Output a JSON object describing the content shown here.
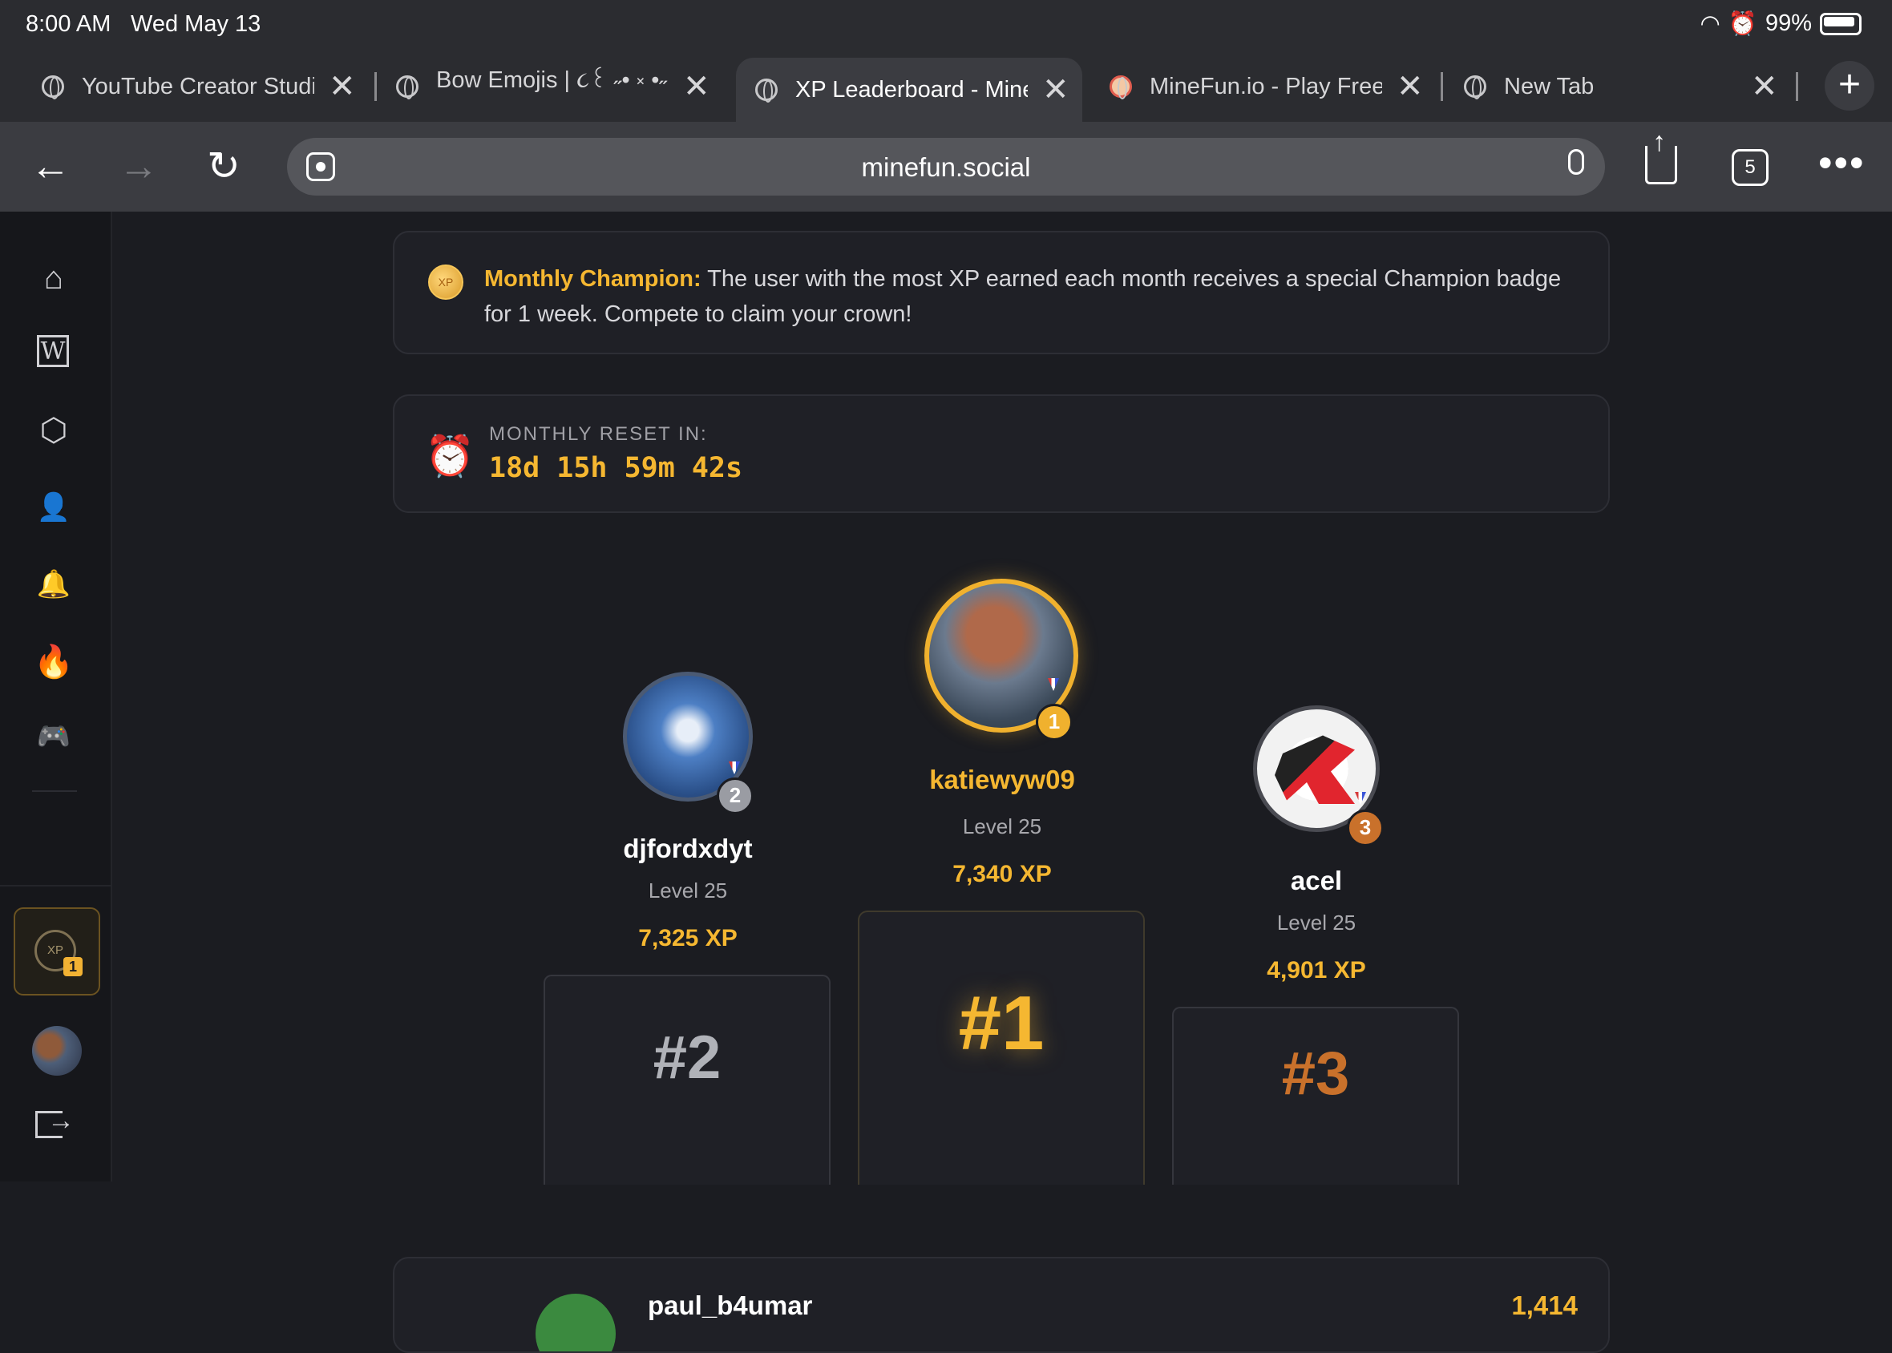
{
  "status": {
    "time": "8:00 AM",
    "date": "Wed May 13",
    "battery": "99%"
  },
  "tabs": [
    {
      "title": "YouTube Creator Studio"
    },
    {
      "title": "Bow Emojis | ૮꒰ ˶• ༝ •˶꒱ა"
    },
    {
      "title": "XP Leaderboard - MineFun"
    },
    {
      "title": "MineFun.io - Play Free"
    },
    {
      "title": "New Tab"
    }
  ],
  "toolbar": {
    "url": "minefun.social",
    "tab_count": "5"
  },
  "sidebar": {
    "icons": [
      "home-icon",
      "wiki-icon",
      "cube-icon",
      "add-user-icon",
      "bell-icon",
      "fire-icon",
      "discord-icon"
    ],
    "xp_badge": "1",
    "xp_ring_label": "XP"
  },
  "champion": {
    "label": "Monthly Champion:",
    "text": " The user with the most XP earned each month receives a special Champion badge for 1 week. Compete to claim your crown!",
    "coin": "XP"
  },
  "reset": {
    "label": "MONTHLY RESET IN:",
    "time": "18d 15h 59m 42s"
  },
  "podium": {
    "first": {
      "name": "katiewyw09",
      "level": "Level 25",
      "xp": "7,340 XP",
      "rank": "#1",
      "badge": "1"
    },
    "second": {
      "name": "djfordxdyt",
      "level": "Level 25",
      "xp": "7,325 XP",
      "rank": "#2",
      "badge": "2"
    },
    "third": {
      "name": "acel",
      "level": "Level 25",
      "xp": "4,901 XP",
      "rank": "#3",
      "badge": "3"
    }
  },
  "next_entry": {
    "name": "paul_b4umar",
    "xp": "1,414"
  },
  "colors": {
    "gold": "#f5b731",
    "silver": "#9a9ca3",
    "bronze": "#c9712b",
    "bg": "#1b1c21"
  }
}
